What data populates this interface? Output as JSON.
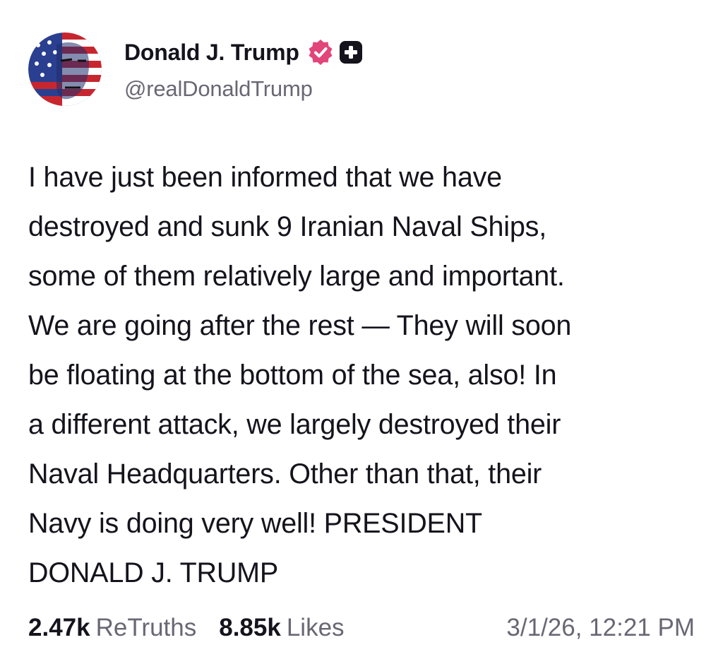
{
  "author": {
    "display_name": "Donald J. Trump",
    "handle": "@realDonaldTrump",
    "avatar_icon": "flag-portrait-avatar",
    "verified_icon": "verified-badge-icon",
    "plus_icon": "plus-badge-icon"
  },
  "post": {
    "lines": [
      "I have just been informed that we have",
      "destroyed and sunk 9 Iranian Naval Ships,",
      "some of them relatively large and important.",
      "We are going after the rest — They will soon",
      "be floating at the bottom of the sea, also! In",
      "a different attack, we largely destroyed their",
      "Naval Headquarters. Other than that, their",
      "Navy is doing very well! PRESIDENT",
      "DONALD J. TRUMP"
    ]
  },
  "stats": {
    "retruths_count": "2.47k",
    "retruths_label": "ReTruths",
    "likes_count": "8.85k",
    "likes_label": "Likes",
    "timestamp": "3/1/26, 12:21 PM"
  },
  "colors": {
    "verified_badge": "#e2457a",
    "text_primary": "#15131c",
    "text_secondary": "#6a6774"
  }
}
